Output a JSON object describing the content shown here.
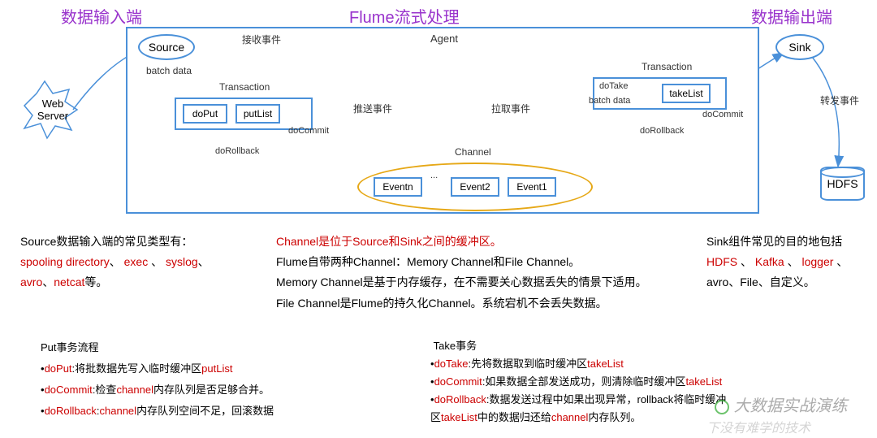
{
  "headers": {
    "input": "数据输入端",
    "processing": "Flume流式处理",
    "output": "数据输出端"
  },
  "diagram": {
    "agent": "Agent",
    "source": "Source",
    "sink": "Sink",
    "webServer": "Web\nServer",
    "hdfs": "HDFS",
    "receiveEvent": "接收事件",
    "batchData1": "batch data",
    "batchData2": "batch data",
    "transaction1": "Transaction",
    "transaction2": "Transaction",
    "doPut": "doPut",
    "putList": "putList",
    "doCommit1": "doCommit",
    "doRollback1": "doRollback",
    "pushEvent": "推送事件",
    "pullEvent": "拉取事件",
    "channel": "Channel",
    "event1": "Event1",
    "event2": "Event2",
    "eventn": "Eventn",
    "doTake": "doTake",
    "takeList": "takeList",
    "doCommit2": "doCommit",
    "doRollback2": "doRollback",
    "forwardEvent": "转发事件"
  },
  "sourceText": {
    "line1": "Source数据输入端的常见类型有：",
    "line2a": "spooling directory",
    "line2b": "exec",
    "line2c": "syslog",
    "line3a": "avro",
    "line3b": "netcat",
    "line3c": "等。"
  },
  "channelText": {
    "line1a": "Channel是位于Source和Sink之间的缓冲区。",
    "line2": "Flume自带两种Channel：Memory Channel和File Channel。",
    "line3": "Memory Channel是基于内存缓存，在不需要关心数据丢失的情景下适用。",
    "line4": "File Channel是Flume的持久化Channel。系统宕机不会丢失数据。"
  },
  "sinkText": {
    "line1": "Sink组件常见的目的地包括",
    "line2a": "HDFS",
    "line2b": "Kafka",
    "line2c": "logger",
    "line3": "avro、File、自定义。"
  },
  "putFlow": {
    "title": "Put事务流程",
    "b1a": "doPut",
    "b1b": ":将批数据先写入临时缓冲区",
    "b1c": "putList",
    "b2a": "doCommit",
    "b2b": ":检查",
    "b2c": "channel",
    "b2d": "内存队列是否足够合并。",
    "b3a": "doRollback",
    "b3b": ":",
    "b3c": "channel",
    "b3d": "内存队列空间不足，回滚数据"
  },
  "takeFlow": {
    "title": "Take事务",
    "b1a": "doTake",
    "b1b": ":先将数据取到临时缓冲区",
    "b1c": "takeList",
    "b2a": "doCommit",
    "b2b": ":如果数据全部发送成功，则清除临时缓冲区",
    "b2c": "takeList",
    "b3a": "doRollback",
    "b3b": ":数据发送过程中如果出现异常，rollback将临时缓冲",
    "b4a": "区",
    "b4b": "takeList",
    "b4c": "中的数据归还给",
    "b4d": "channel",
    "b4e": "内存队列。"
  },
  "watermark1": "大数据实战演练",
  "watermark2": "下没有难学的技术"
}
